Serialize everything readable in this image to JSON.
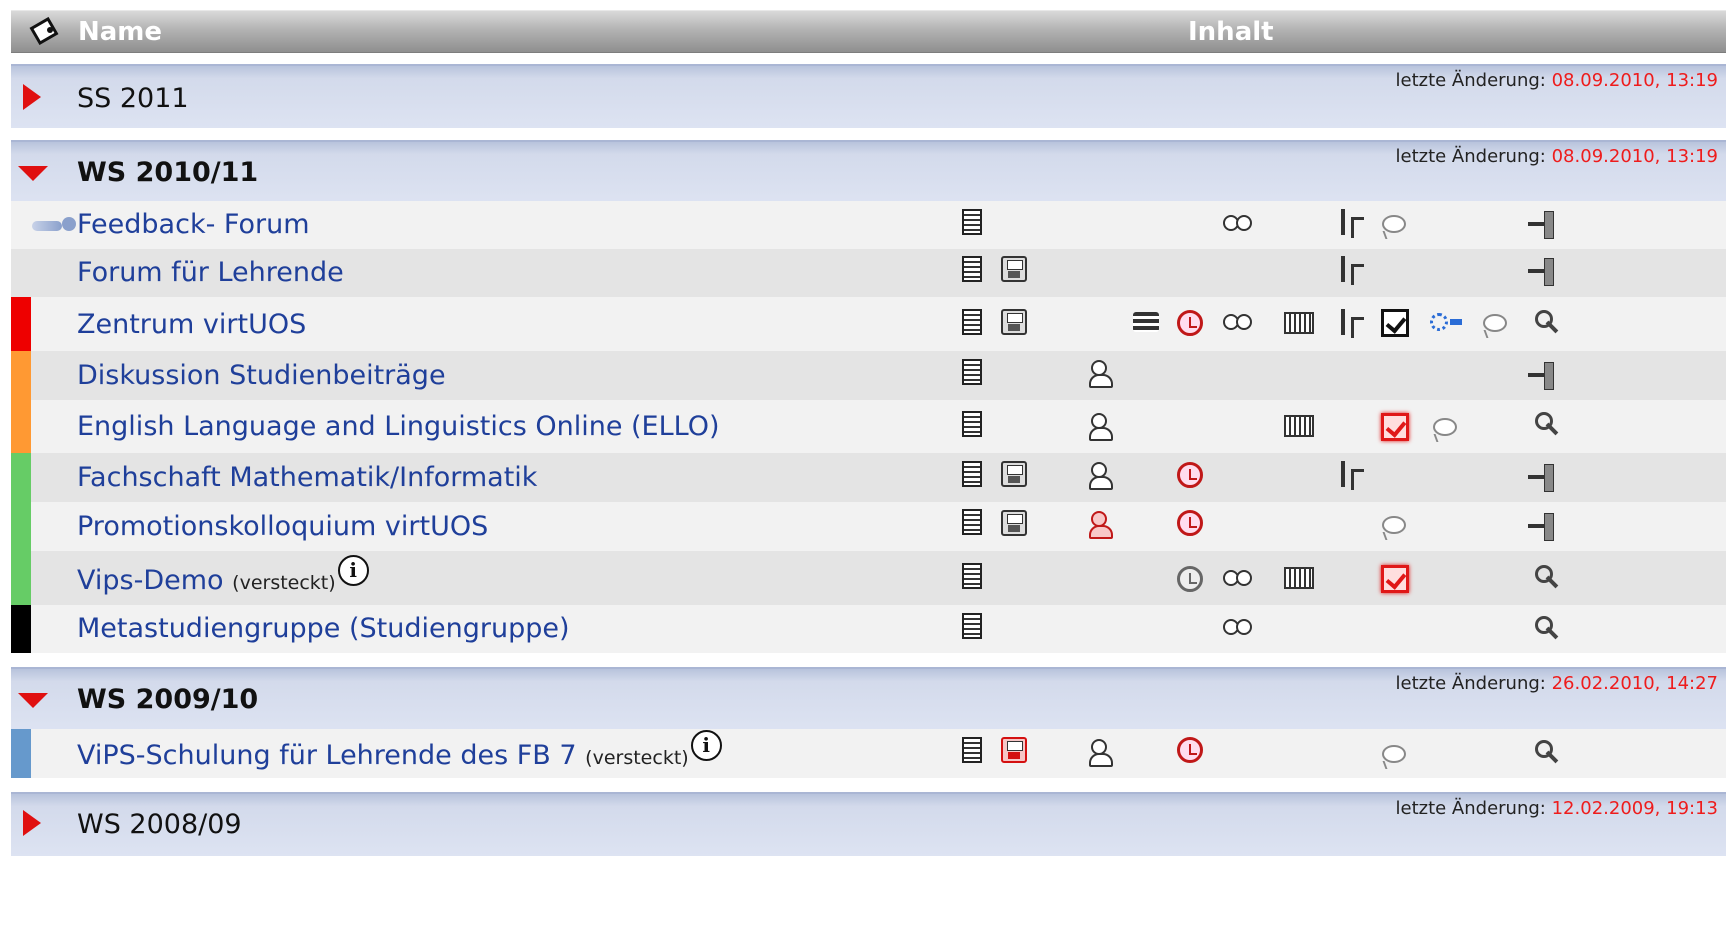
{
  "header": {
    "name_label": "Name",
    "content_label": "Inhalt",
    "settings_icon": "paint-bucket-icon"
  },
  "semesters": [
    {
      "title": "SS 2011",
      "expanded": false,
      "changed_label": "letzte Änderung:",
      "changed_date": "08.09.2010, 13:19"
    },
    {
      "title": "WS 2010/11",
      "expanded": true,
      "changed_label": "letzte Änderung:",
      "changed_date": "08.09.2010, 13:19"
    },
    {
      "title": "WS 2009/10",
      "expanded": true,
      "changed_label": "letzte Änderung:",
      "changed_date": "26.02.2010, 14:27"
    },
    {
      "title": "WS 2008/09",
      "expanded": false,
      "changed_label": "letzte Änderung:",
      "changed_date": "12.02.2009, 19:13"
    }
  ],
  "courses": [
    {
      "name": "Feedback- Forum",
      "suffix": "",
      "color": "",
      "has_logo": true
    },
    {
      "name": "Forum für Lehrende",
      "suffix": "",
      "color": ""
    },
    {
      "name": "Zentrum virtUOS",
      "suffix": "",
      "color": "#ee0000"
    },
    {
      "name": "Diskussion Studienbeiträge",
      "suffix": "",
      "color": "#ff9933"
    },
    {
      "name": "English Language and Linguistics Online (ELLO)",
      "suffix": "",
      "color": "#ff9933"
    },
    {
      "name": "Fachschaft Mathematik/Informatik",
      "suffix": "",
      "color": "#66cc66"
    },
    {
      "name": "Promotionskolloquium virtUOS",
      "suffix": "",
      "color": "#66cc66"
    },
    {
      "name": "Vips-Demo",
      "suffix": "(versteckt)",
      "color": "#66cc66",
      "info": "i"
    },
    {
      "name": "Metastudiengruppe (Studiengruppe)",
      "suffix": "",
      "color": "#000000"
    },
    {
      "name": "ViPS-Schulung für Lehrende des FB 7",
      "suffix": "(versteckt)",
      "color": "#6699cc",
      "info": "i"
    }
  ]
}
